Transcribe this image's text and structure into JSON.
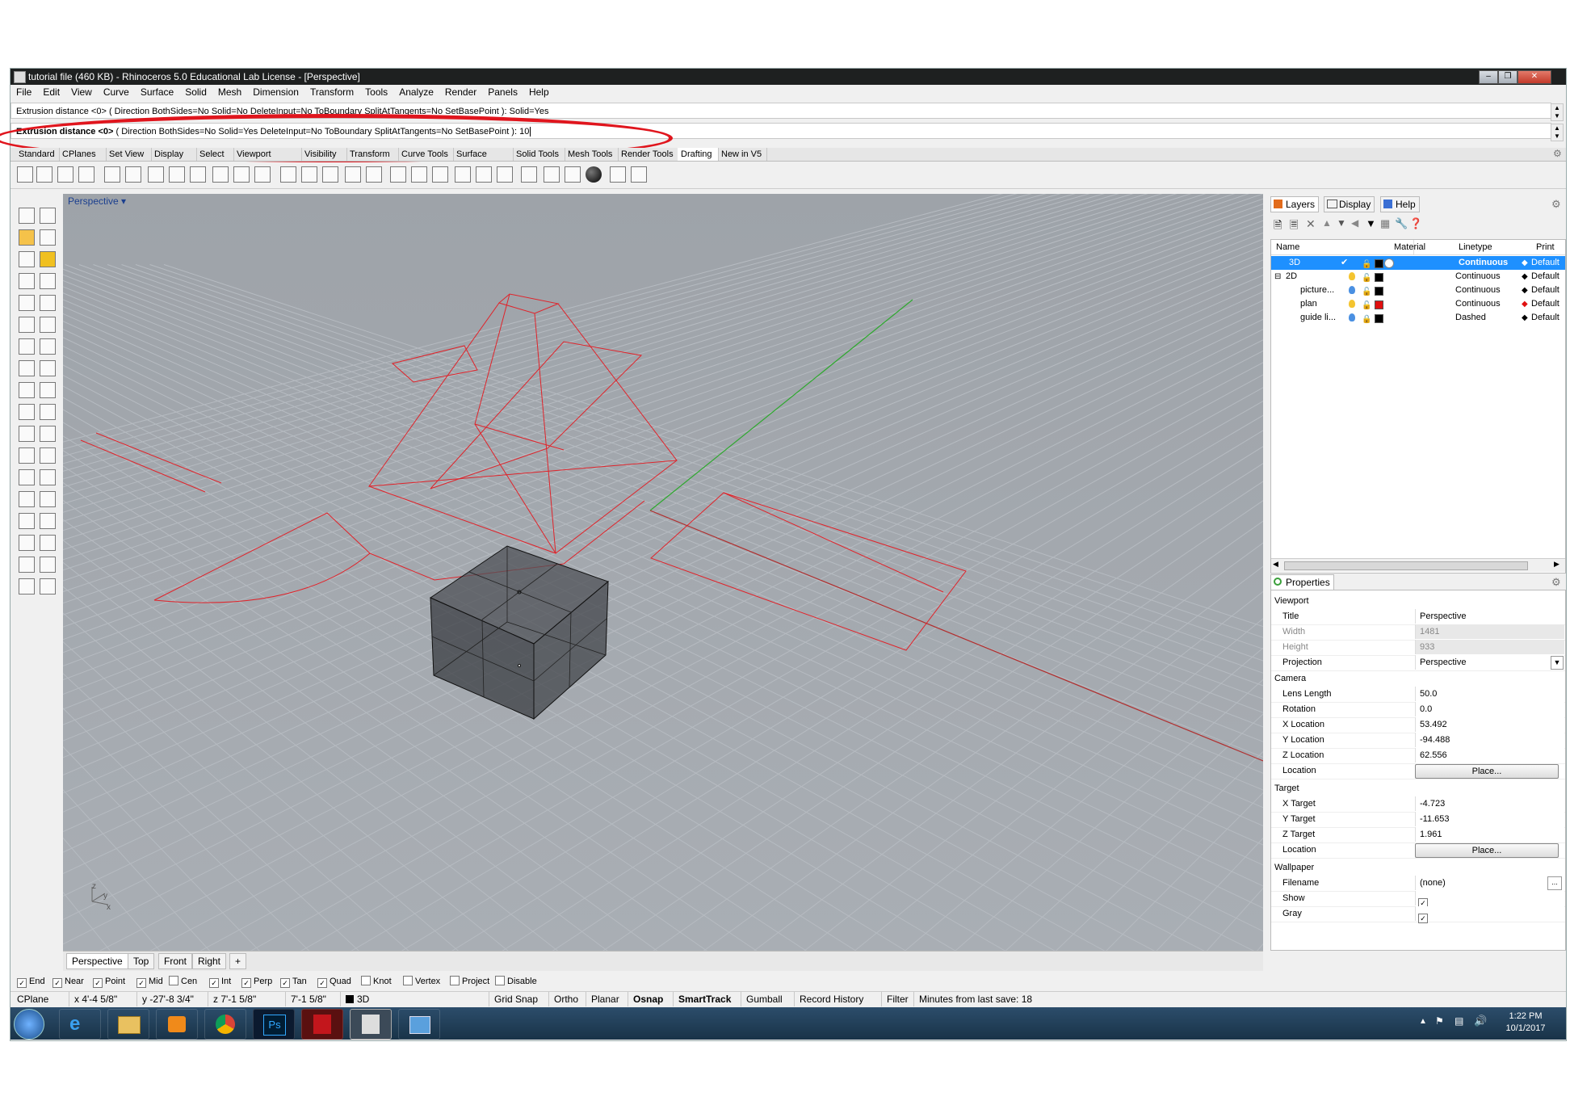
{
  "window": {
    "title": "tutorial file (460 KB) - Rhinoceros 5.0 Educational Lab License - [Perspective]"
  },
  "menu": [
    "File",
    "Edit",
    "View",
    "Curve",
    "Surface",
    "Solid",
    "Mesh",
    "Dimension",
    "Transform",
    "Tools",
    "Analyze",
    "Render",
    "Panels",
    "Help"
  ],
  "command": {
    "history": "Extrusion distance <0> ( Direction BothSides=No Solid=No DeleteInput=No ToBoundary SplitAtTangents=No SetBasePoint ): Solid=Yes",
    "prompt_bold": "Extrusion distance <0>",
    "prompt_rest": " ( Direction BothSides=No Solid=Yes DeleteInput=No ToBoundary SplitAtTangents=No SetBasePoint ): 10"
  },
  "toolbar_tabs": [
    "Standard",
    "CPlanes",
    "Set View",
    "Display",
    "Select",
    "Viewport Layout",
    "Visibility",
    "Transform",
    "Curve Tools",
    "Surface Tools",
    "Solid Tools",
    "Mesh Tools",
    "Render Tools",
    "Drafting",
    "New in V5"
  ],
  "active_toolbar_tab": "Drafting",
  "viewport": {
    "label": "Perspective",
    "axis_x": "x",
    "axis_y": "y",
    "axis_z": "z"
  },
  "viewport_tabs": [
    "Perspective",
    "Top",
    "Front",
    "Right"
  ],
  "panel_tabs": {
    "layers": "Layers",
    "display": "Display",
    "help": "Help",
    "properties": "Properties"
  },
  "layers": {
    "headers": [
      "Name",
      "Material",
      "Linetype",
      "Print W"
    ],
    "rows": [
      {
        "name": "3D",
        "linetype": "Continuous",
        "print": "Default",
        "color": "#000000",
        "selected": true,
        "check": "✔"
      },
      {
        "name": "2D",
        "linetype": "Continuous",
        "print": "Default",
        "color": "#000000",
        "selected": false,
        "check": ""
      },
      {
        "name": "picture...",
        "linetype": "Continuous",
        "print": "Default",
        "color": "#000000",
        "selected": false,
        "check": ""
      },
      {
        "name": "plan",
        "linetype": "Continuous",
        "print": "Default",
        "color": "#e01010",
        "selected": false,
        "check": ""
      },
      {
        "name": "guide li...",
        "linetype": "Dashed",
        "print": "Default",
        "color": "#000000",
        "selected": false,
        "check": ""
      }
    ]
  },
  "properties": {
    "viewport_head": "Viewport",
    "title_k": "Title",
    "title_v": "Perspective",
    "width_k": "Width",
    "width_v": "1481",
    "height_k": "Height",
    "height_v": "933",
    "projection_k": "Projection",
    "projection_v": "Perspective",
    "camera_head": "Camera",
    "lens_k": "Lens Length",
    "lens_v": "50.0",
    "rotation_k": "Rotation",
    "rotation_v": "0.0",
    "xloc_k": "X Location",
    "xloc_v": "53.492",
    "yloc_k": "Y Location",
    "yloc_v": "-94.488",
    "zloc_k": "Z Location",
    "zloc_v": "62.556",
    "location_k": "Location",
    "place_label": "Place...",
    "target_head": "Target",
    "xt_k": "X Target",
    "xt_v": "-4.723",
    "yt_k": "Y Target",
    "yt_v": "-11.653",
    "zt_k": "Z Target",
    "zt_v": "1.961",
    "wallpaper_head": "Wallpaper",
    "filename_k": "Filename",
    "filename_v": "(none)",
    "show_k": "Show",
    "gray_k": "Gray"
  },
  "osnaps": [
    {
      "label": "End",
      "checked": true
    },
    {
      "label": "Near",
      "checked": true
    },
    {
      "label": "Point",
      "checked": true
    },
    {
      "label": "Mid",
      "checked": true
    },
    {
      "label": "Cen",
      "checked": false
    },
    {
      "label": "Int",
      "checked": true
    },
    {
      "label": "Perp",
      "checked": true
    },
    {
      "label": "Tan",
      "checked": true
    },
    {
      "label": "Quad",
      "checked": true
    },
    {
      "label": "Knot",
      "checked": false
    },
    {
      "label": "Vertex",
      "checked": false
    },
    {
      "label": "Project",
      "checked": false
    },
    {
      "label": "Disable",
      "checked": false
    }
  ],
  "status": {
    "cplane": "CPlane",
    "x": "x 4'-4 5/8\"",
    "y": "y -27'-8 3/4\"",
    "z": "z 7'-1 5/8\"",
    "dist": "7'-1 5/8\"",
    "layer": "3D",
    "grid_snap": "Grid Snap",
    "ortho": "Ortho",
    "planar": "Planar",
    "osnap": "Osnap",
    "smarttrack": "SmartTrack",
    "gumball": "Gumball",
    "record": "Record History",
    "filter": "Filter",
    "save": "Minutes from last save: 18"
  },
  "clock": {
    "time": "1:22 PM",
    "date": "10/1/2017"
  },
  "colors": {
    "curve_red": "#e0232a",
    "axis_green": "#2ea82e",
    "axis_red": "#b03030",
    "highlight": "#e0151d",
    "selection_blue": "#1e90ff"
  }
}
